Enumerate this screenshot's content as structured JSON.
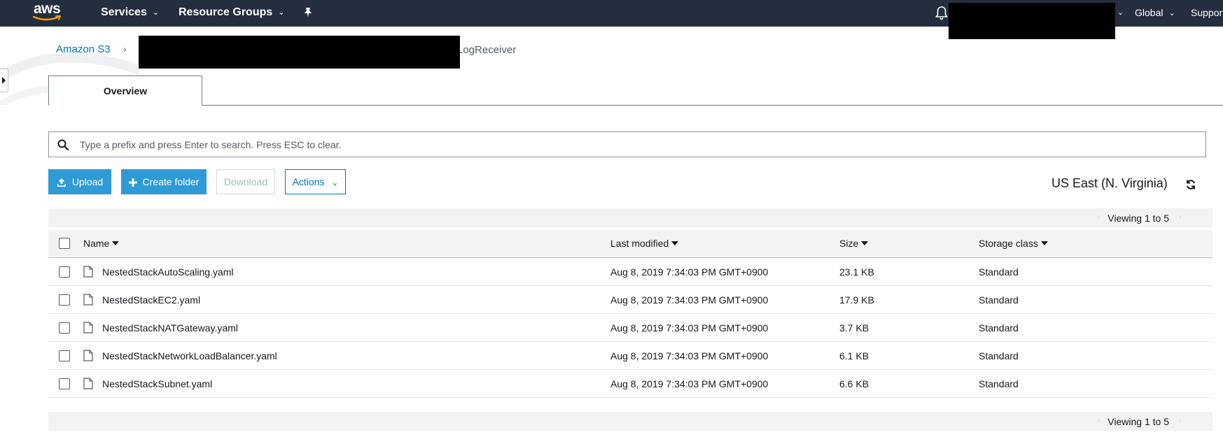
{
  "topnav": {
    "logo_text": "aws",
    "services_label": "Services",
    "resource_groups_label": "Resource Groups",
    "global_label": "Global",
    "support_label": "Support"
  },
  "breadcrumb": {
    "root_label": "Amazon S3",
    "separator": "›",
    "current_suffix": "LogReceiver"
  },
  "tabs": [
    {
      "label": "Overview",
      "active": true
    }
  ],
  "search": {
    "placeholder": "Type a prefix and press Enter to search. Press ESC to clear.",
    "value": ""
  },
  "toolbar": {
    "upload_label": "Upload",
    "create_folder_label": "Create folder",
    "download_label": "Download",
    "actions_label": "Actions",
    "region_label": "US East (N. Virginia)"
  },
  "table": {
    "viewing_top": "Viewing 1 to 5",
    "viewing_bottom": "Viewing 1 to 5",
    "columns": {
      "name": "Name",
      "last_modified": "Last modified",
      "size": "Size",
      "storage_class": "Storage class"
    },
    "rows": [
      {
        "name": "NestedStackAutoScaling.yaml",
        "last_modified": "Aug 8, 2019 7:34:03 PM GMT+0900",
        "size": "23.1 KB",
        "storage_class": "Standard"
      },
      {
        "name": "NestedStackEC2.yaml",
        "last_modified": "Aug 8, 2019 7:34:03 PM GMT+0900",
        "size": "17.9 KB",
        "storage_class": "Standard"
      },
      {
        "name": "NestedStackNATGateway.yaml",
        "last_modified": "Aug 8, 2019 7:34:03 PM GMT+0900",
        "size": "3.7 KB",
        "storage_class": "Standard"
      },
      {
        "name": "NestedStackNetworkLoadBalancer.yaml",
        "last_modified": "Aug 8, 2019 7:34:03 PM GMT+0900",
        "size": "6.1 KB",
        "storage_class": "Standard"
      },
      {
        "name": "NestedStackSubnet.yaml",
        "last_modified": "Aug 8, 2019 7:34:03 PM GMT+0900",
        "size": "6.6 KB",
        "storage_class": "Standard"
      }
    ]
  },
  "colors": {
    "topnav_bg": "#232f3e",
    "primary_button": "#2e9bd6",
    "link": "#0073bb",
    "aws_smile": "#ff9900"
  },
  "icons": [
    "aws-smile-icon",
    "chevron-down-icon",
    "pin-icon",
    "bell-icon",
    "search-icon",
    "upload-icon",
    "plus-icon",
    "refresh-icon",
    "file-icon",
    "sort-caret-icon",
    "sidebar-toggle-icon"
  ]
}
